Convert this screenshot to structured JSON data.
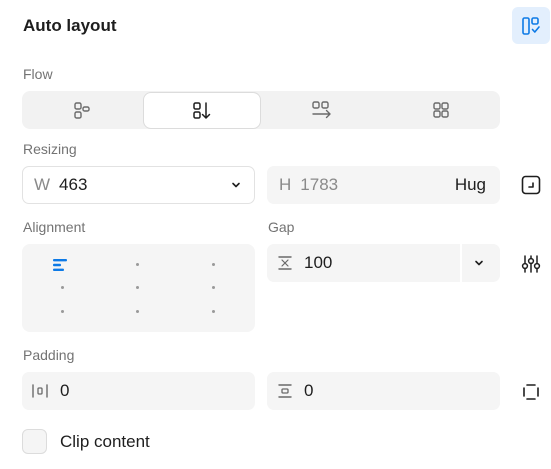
{
  "panel": {
    "title": "Auto layout"
  },
  "flow": {
    "label": "Flow",
    "options": [
      "wrap",
      "vertical",
      "horizontal",
      "grid"
    ],
    "selected": "vertical"
  },
  "resizing": {
    "label": "Resizing",
    "width": {
      "prefix": "W",
      "value": "463"
    },
    "height": {
      "prefix": "H",
      "value": "1783",
      "mode": "Hug"
    }
  },
  "alignment": {
    "label": "Alignment",
    "selected": "top-left"
  },
  "gap": {
    "label": "Gap",
    "value": "100"
  },
  "padding": {
    "label": "Padding",
    "horizontal": "0",
    "vertical": "0"
  },
  "clip": {
    "label": "Clip content",
    "checked": false
  },
  "colors": {
    "accent": "#0d7ae6",
    "active_bg": "#e3effd"
  }
}
